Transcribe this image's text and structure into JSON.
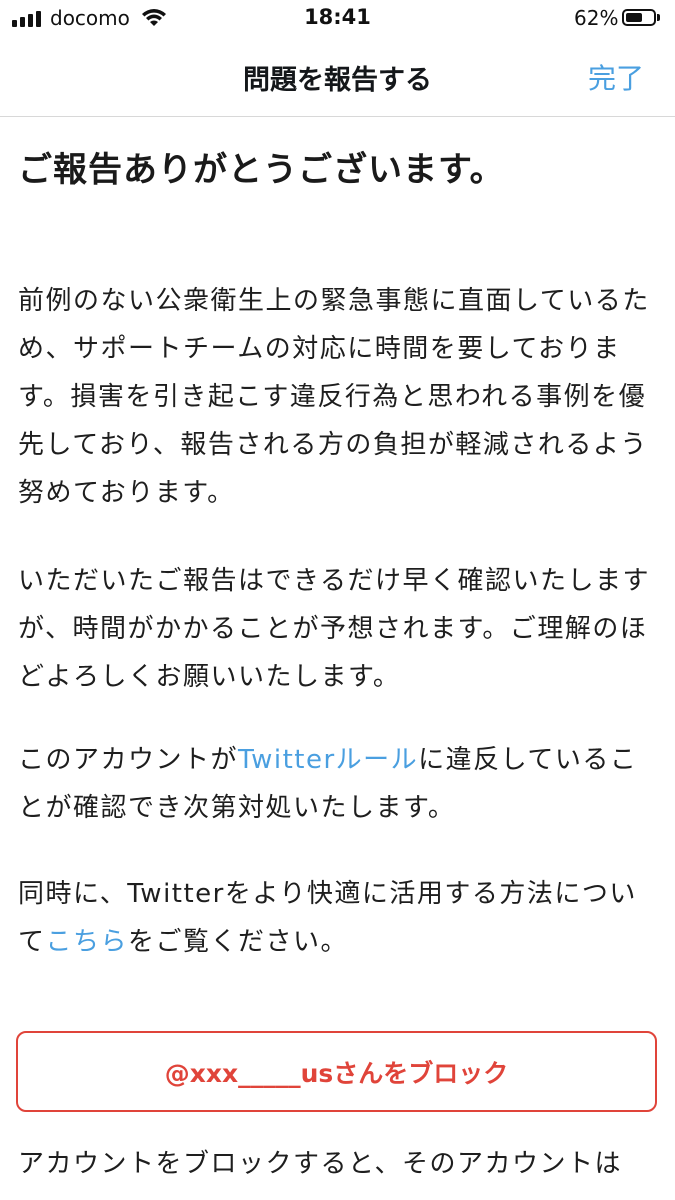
{
  "status_bar": {
    "carrier": "docomo",
    "time": "18:41",
    "battery_percent": "62%",
    "battery_level": 0.62
  },
  "nav": {
    "title": "問題を報告する",
    "done_label": "完了"
  },
  "content": {
    "heading": "ご報告ありがとうございます。",
    "paragraph1": "前例のない公衆衛生上の緊急事態に直面しているため、サポートチームの対応に時間を要しております。損害を引き起こす違反行為と思われる事例を優先しており、報告される方の負担が軽減されるよう努めております。",
    "paragraph2": "いただいたご報告はできるだけ早く確認いたしますが、時間がかかることが予想されます。ご理解のほどよろしくお願いいたします。",
    "paragraph3_before": "このアカウントが",
    "paragraph3_link": "Twitterルール",
    "paragraph3_after": "に違反していることが確認でき次第対処いたします。",
    "paragraph4_before": "同時に、Twitterをより快適に活用する方法について",
    "paragraph4_link": "こちら",
    "paragraph4_after": "をご覧ください。",
    "block_button_label": "@xxx_____usさんをブロック",
    "paragraph5": "アカウントをブロックすると、そのアカウントは"
  },
  "colors": {
    "link": "#4a9fe0",
    "danger": "#e0443a"
  }
}
